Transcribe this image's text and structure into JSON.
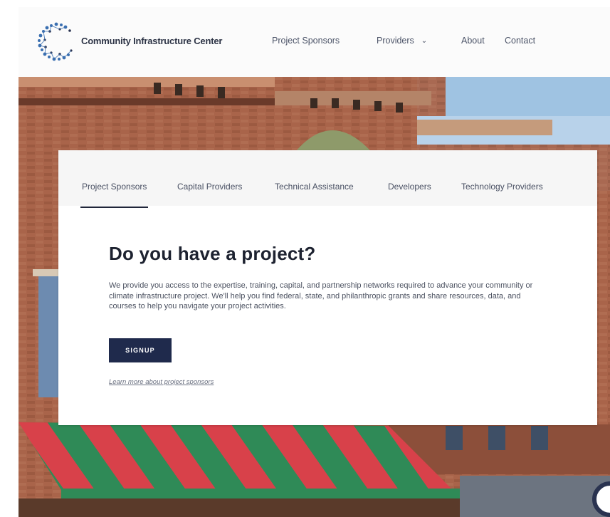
{
  "header": {
    "brand": "Community Infrastructure Center",
    "nav": [
      {
        "label": "Project Sponsors",
        "has_dropdown": false
      },
      {
        "label": "Providers",
        "has_dropdown": true
      },
      {
        "label": "About",
        "has_dropdown": false
      },
      {
        "label": "Contact",
        "has_dropdown": false
      }
    ]
  },
  "tabs": [
    {
      "label": "Project Sponsors",
      "active": true
    },
    {
      "label": "Capital Providers",
      "active": false
    },
    {
      "label": "Technical Assistance",
      "active": false
    },
    {
      "label": "Developers",
      "active": false
    },
    {
      "label": "Technology Providers",
      "active": false
    }
  ],
  "main": {
    "headline": "Do you have a project?",
    "description": "We provide you access to the expertise, training, capital, and partnership networks required to advance your community or climate infrastructure project. We'll help you find federal, state, and philanthropic grants and share resources, data, and courses to help you navigate your project activities.",
    "signup_label": "SIGNUP",
    "learn_more": "Learn more about project sponsors"
  },
  "colors": {
    "accent": "#1f2a4c",
    "awning_red": "#d8414a",
    "awning_green": "#2f8a57",
    "brick": "#a9644a",
    "sky": "#9fc3e2"
  },
  "icons": {
    "logo": "dotted-c-logo",
    "dropdown": "chevron-down-icon",
    "corner": "chat-widget-icon"
  }
}
